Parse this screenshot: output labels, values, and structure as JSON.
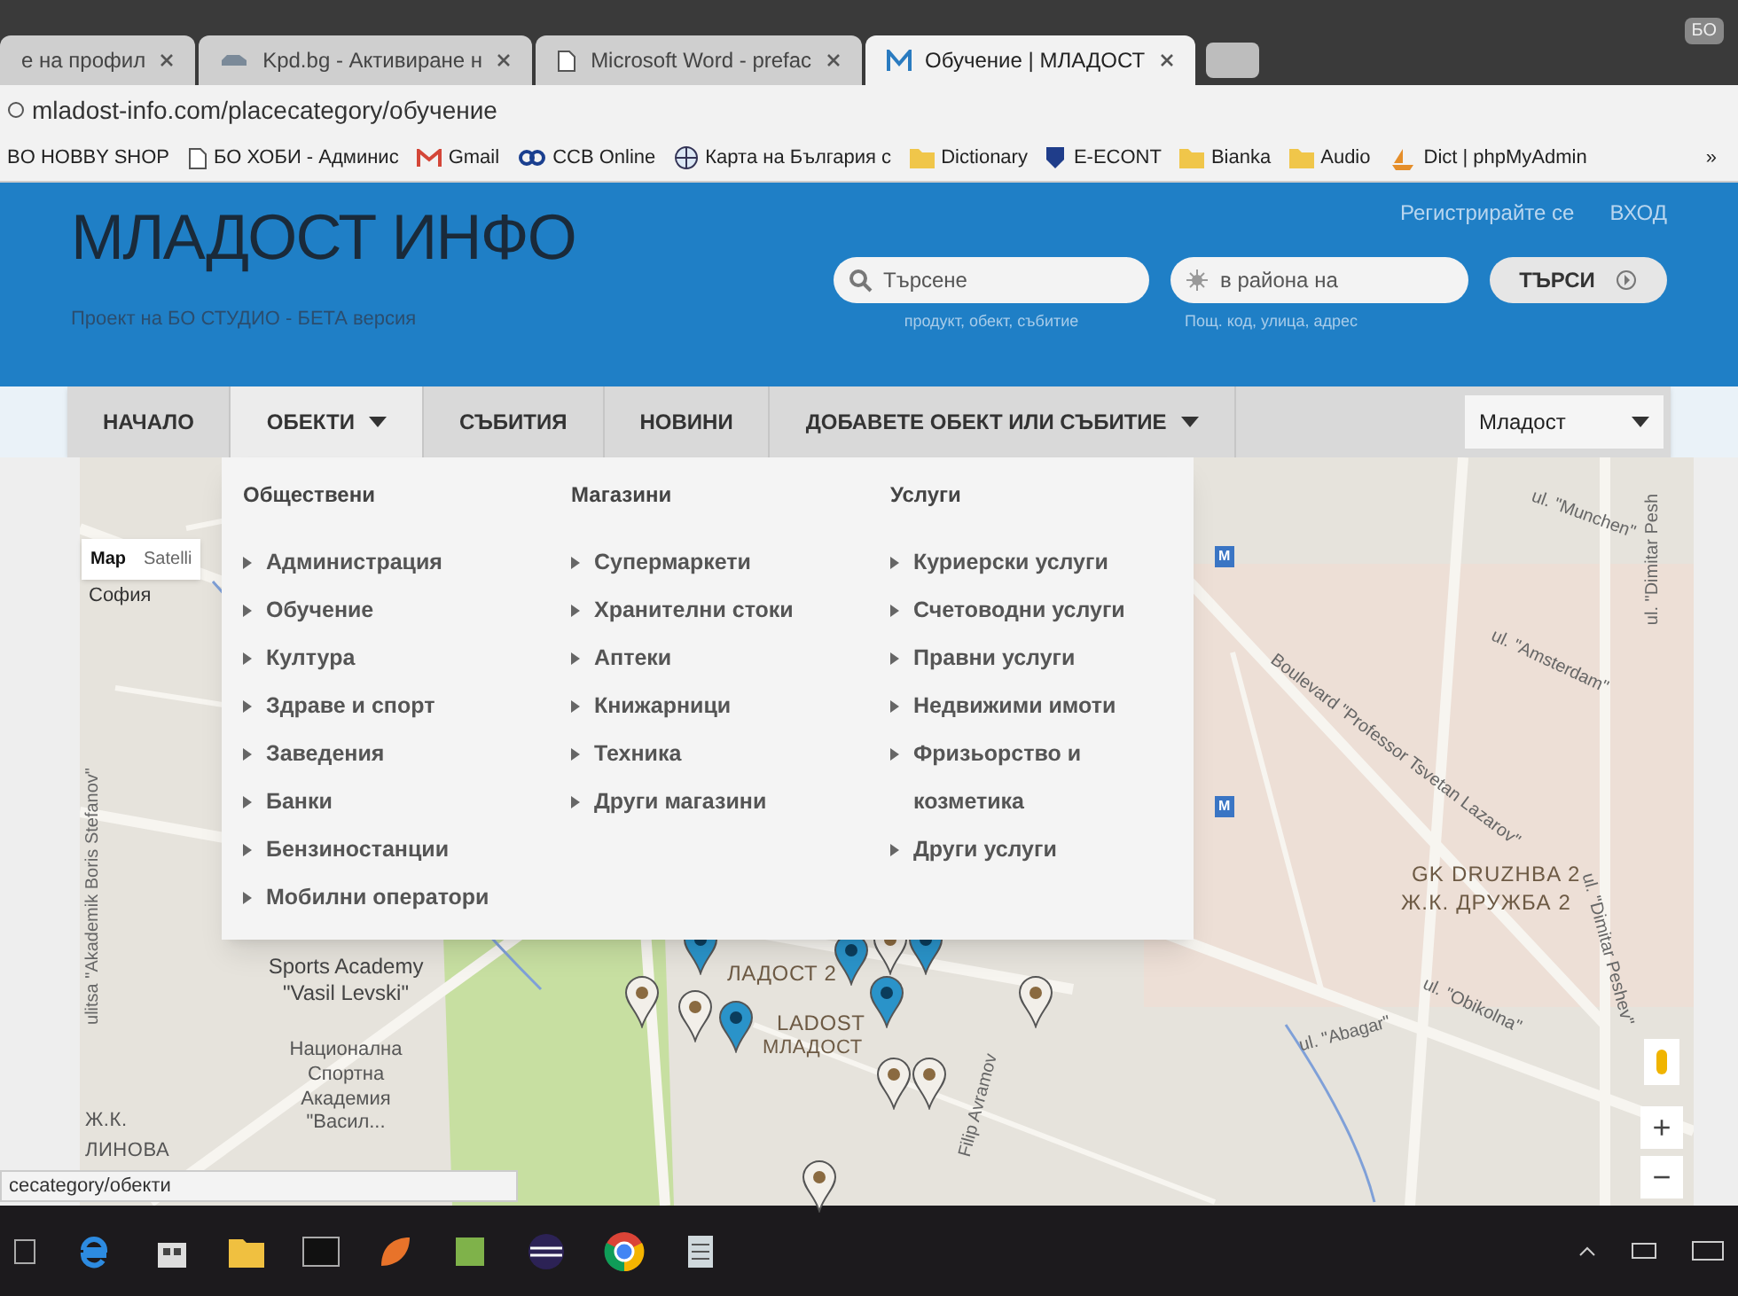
{
  "browser": {
    "tabs": [
      {
        "title": "е на профил",
        "selected": false
      },
      {
        "title": "Kpd.bg - Активиране н",
        "selected": false
      },
      {
        "title": "Microsoft Word - prefac",
        "selected": false
      },
      {
        "title": "Обучение | МЛАДОСТ",
        "selected": true
      }
    ],
    "profile": "БО",
    "address": "mladost-info.com/placecategory/обучение",
    "bookmarks": [
      {
        "label": "BO HOBBY SHOP",
        "kind": "plain"
      },
      {
        "label": "БО ХОБИ - Админис",
        "kind": "page"
      },
      {
        "label": "Gmail",
        "kind": "mail"
      },
      {
        "label": "CCB Online",
        "kind": "link"
      },
      {
        "label": "Карта на България с",
        "kind": "globe"
      },
      {
        "label": "Dictionary",
        "kind": "folder"
      },
      {
        "label": "E-ECONT",
        "kind": "econt"
      },
      {
        "label": "Bianka",
        "kind": "folder"
      },
      {
        "label": "Audio",
        "kind": "folder"
      },
      {
        "label": "Dict | phpMyAdmin",
        "kind": "pma"
      }
    ],
    "more": "»"
  },
  "header": {
    "title": "МЛАДОСТ ИНФО",
    "subtitle": "Проект на БО СТУДИО - БЕТА версия",
    "links": [
      "Регистрирайте се",
      "ВХОД"
    ],
    "search": {
      "placeholder": "Търсене",
      "hint": "продукт, обект, събитие"
    },
    "area": {
      "placeholder": "в района на",
      "hint": "Пощ. код, улица, адрес"
    },
    "button": "ТЪРСИ"
  },
  "nav": {
    "items": [
      {
        "label": "НАЧАЛО",
        "selected": false,
        "dropdown": false
      },
      {
        "label": "ОБЕКТИ",
        "selected": true,
        "dropdown": true
      },
      {
        "label": "СЪБИТИЯ",
        "selected": false,
        "dropdown": false
      },
      {
        "label": "НОВИНИ",
        "selected": false,
        "dropdown": false
      },
      {
        "label": "ДОБАВЕТЕ ОБЕКТ ИЛИ СЪБИТИЕ",
        "selected": false,
        "dropdown": true
      }
    ],
    "district": "Младост"
  },
  "mega_menu": {
    "columns": [
      {
        "heading": "Обществени",
        "items": [
          "Администрация",
          "Обучение",
          "Култура",
          "Здраве и спорт",
          "Заведения",
          "Банки",
          "Бензиностанции",
          "Мобилни оператори"
        ]
      },
      {
        "heading": "Магазини",
        "items": [
          "Супермаркети",
          "Хранителни стоки",
          "Аптеки",
          "Книжарници",
          "Техника",
          "Други магазини"
        ]
      },
      {
        "heading": "Услуги",
        "items": [
          "Куриерски услуги",
          "Счетоводни услуги",
          "Правни услуги",
          "Недвижими имоти",
          "Фризьорство и козметика",
          "Други услуги"
        ]
      }
    ]
  },
  "map": {
    "type_tabs": [
      {
        "label": "Map",
        "selected": true
      },
      {
        "label": "Satelli",
        "selected": false
      }
    ],
    "labels": [
      "София",
      "ulitsa \"Akademik Boris Stefanov\"",
      "Sports Academy \"Vasil Levski\"",
      "Национална Спортна Академия \"Васил...",
      "Ж.К. ЛИНОВА",
      "ЛАДОСТ 2",
      "LADOST",
      "МЛАДОСТ",
      "Filip Avramov",
      "ul. \"Abagar\"",
      "ul. \"Obikolna\"",
      "ul. \"Dimitar Peshev\"",
      "ul. \"Munchen\"",
      "ul. \"Dimitar Pesh",
      "ul. \"Amsterdam\"",
      "Boulevard \"Professor Tsvetan Lazarov\"",
      "GK DRUZHBA 2",
      "Ж.К. ДРУЖБА 2"
    ],
    "metro": [
      "M",
      "M"
    ],
    "zoom_in": "+",
    "zoom_out": "−"
  },
  "status_bar": "cecategory/обекти"
}
